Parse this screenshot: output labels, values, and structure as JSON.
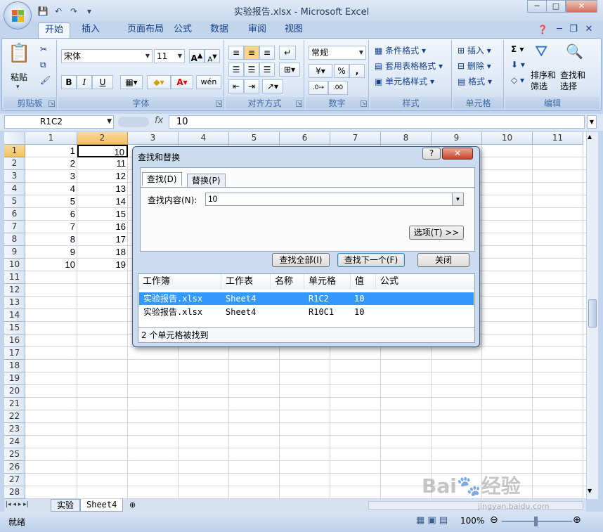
{
  "window": {
    "title": "实验报告.xlsx - Microsoft Excel"
  },
  "qat": {
    "save_icon": "save-icon",
    "undo_icon": "undo-icon",
    "redo_icon": "redo-icon"
  },
  "tabs": [
    "开始",
    "插入",
    "页面布局",
    "公式",
    "数据",
    "审阅",
    "视图"
  ],
  "ribbon": {
    "clipboard": {
      "label": "剪贴板",
      "paste": "粘贴"
    },
    "font": {
      "label": "字体",
      "name": "宋体",
      "size": "11",
      "bold": "B",
      "italic": "I",
      "underline": "U"
    },
    "alignment": {
      "label": "对齐方式"
    },
    "number": {
      "label": "数字",
      "format": "常规",
      "percent": "%",
      "comma": ","
    },
    "styles": {
      "label": "样式",
      "conditional": "条件格式",
      "table": "套用表格格式",
      "cell": "单元格样式"
    },
    "cells": {
      "label": "单元格",
      "insert": "插入",
      "delete": "删除",
      "format": "格式"
    },
    "editing": {
      "label": "编辑",
      "sort": "排序和\n筛选",
      "find": "查找和\n选择",
      "sigma": "Σ"
    }
  },
  "formula_bar": {
    "name_box": "R1C2",
    "fx": "fx",
    "value": "10"
  },
  "grid": {
    "columns": [
      "1",
      "2",
      "3",
      "4",
      "5",
      "6",
      "7",
      "8",
      "9",
      "10",
      "11"
    ],
    "rows": [
      "1",
      "2",
      "3",
      "4",
      "5",
      "6",
      "7",
      "8",
      "9",
      "10",
      "11",
      "12",
      "13",
      "14",
      "15",
      "16",
      "17",
      "18",
      "19",
      "20",
      "21",
      "22",
      "23",
      "24",
      "25",
      "26",
      "27",
      "28"
    ],
    "col1": [
      "1",
      "2",
      "3",
      "4",
      "5",
      "6",
      "7",
      "8",
      "9",
      "10"
    ],
    "col2": [
      "10",
      "11",
      "12",
      "13",
      "14",
      "15",
      "16",
      "17",
      "18",
      "19"
    ]
  },
  "sheets": [
    "实验",
    "Sheet4"
  ],
  "status": {
    "ready": "就绪",
    "zoom": "100%"
  },
  "dialog": {
    "title": "查找和替换",
    "help": "?",
    "close_x": "✕",
    "tab_find": "查找(D)",
    "tab_replace": "替换(P)",
    "find_label": "查找内容(N):",
    "find_value": "10",
    "options": "选项(T) >>",
    "find_all": "查找全部(I)",
    "find_next": "查找下一个(F)",
    "close": "关闭",
    "headers": [
      "工作簿",
      "工作表",
      "名称",
      "单元格",
      "值",
      "公式"
    ],
    "results": [
      {
        "book": "实验报告.xlsx",
        "sheet": "Sheet4",
        "name": "",
        "cell": "R1C2",
        "value": "10",
        "formula": ""
      },
      {
        "book": "实验报告.xlsx",
        "sheet": "Sheet4",
        "name": "",
        "cell": "R10C1",
        "value": "10",
        "formula": ""
      }
    ],
    "footer": "2 个单元格被找到"
  },
  "watermark": {
    "logo": "Bai🐾经验",
    "url": "jingyan.baidu.com"
  }
}
